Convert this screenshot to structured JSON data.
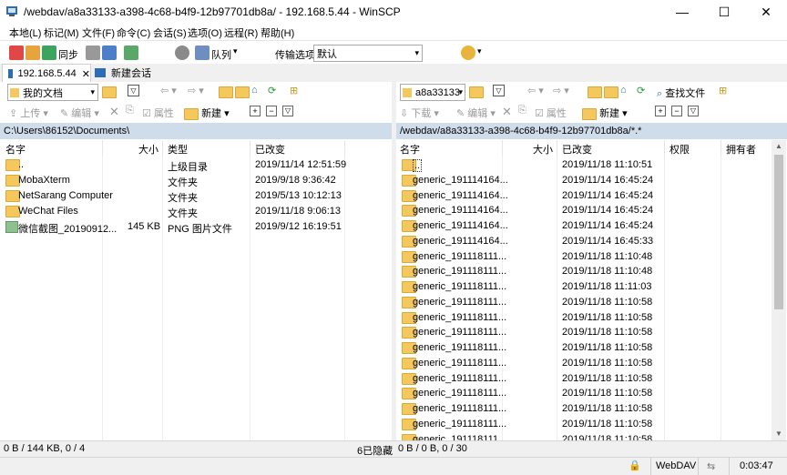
{
  "window": {
    "title": "/webdav/a8a33133-a398-4c68-b4f9-12b97701db8a/ - 192.168.5.44 - WinSCP",
    "minimize": "—",
    "maximize": "☐",
    "close": "✕"
  },
  "menu": [
    "本地(L)",
    "标记(M)",
    "文件(F)",
    "命令(C)",
    "会话(S)",
    "选项(O)",
    "远程(R)",
    "帮助(H)"
  ],
  "toolbar": {
    "sync_label": "同步",
    "queue_label": "队列",
    "transfer_label": "传输选项",
    "transfer_value": "默认"
  },
  "tabs": {
    "session": "192.168.5.44",
    "session_close": "✕",
    "new_session": "新建会话"
  },
  "left": {
    "location": "我的文档",
    "actions": {
      "upload": "上传",
      "edit": "编辑",
      "properties": "属性",
      "new": "新建"
    },
    "path": "C:\\Users\\86152\\Documents\\",
    "columns": [
      "名字",
      "大小",
      "类型",
      "已改变"
    ],
    "rows": [
      {
        "name": "..",
        "size": "",
        "type": "上级目录",
        "changed": "2019/11/14  12:51:59"
      },
      {
        "name": "MobaXterm",
        "size": "",
        "type": "文件夹",
        "changed": "2019/9/18  9:36:42"
      },
      {
        "name": "NetSarang Computer",
        "size": "",
        "type": "文件夹",
        "changed": "2019/5/13  10:12:13"
      },
      {
        "name": "WeChat Files",
        "size": "",
        "type": "文件夹",
        "changed": "2019/11/18  9:06:13"
      },
      {
        "name": "微信截图_20190912...",
        "size": "145 KB",
        "type": "PNG 图片文件",
        "changed": "2019/9/12  16:19:51"
      }
    ],
    "status": "0 B / 144 KB,   0 / 4",
    "hidden": "6已隐藏"
  },
  "right": {
    "location": "a8a33133",
    "find_files": "查找文件",
    "actions": {
      "download": "下载",
      "edit": "编辑",
      "properties": "属性",
      "new": "新建"
    },
    "path": "/webdav/a8a33133-a398-4c68-b4f9-12b97701db8a/*.*",
    "columns": [
      "名字",
      "大小",
      "已改变",
      "权限",
      "拥有者"
    ],
    "rows": [
      {
        "name": "..",
        "changed": "2019/11/18 11:10:51"
      },
      {
        "name": "generic_191114164...",
        "changed": "2019/11/14 16:45:24"
      },
      {
        "name": "generic_191114164...",
        "changed": "2019/11/14 16:45:24"
      },
      {
        "name": "generic_191114164...",
        "changed": "2019/11/14 16:45:24"
      },
      {
        "name": "generic_191114164...",
        "changed": "2019/11/14 16:45:24"
      },
      {
        "name": "generic_191114164...",
        "changed": "2019/11/14 16:45:33"
      },
      {
        "name": "generic_191118111...",
        "changed": "2019/11/18 11:10:48"
      },
      {
        "name": "generic_191118111...",
        "changed": "2019/11/18 11:10:48"
      },
      {
        "name": "generic_191118111...",
        "changed": "2019/11/18 11:11:03"
      },
      {
        "name": "generic_191118111...",
        "changed": "2019/11/18 11:10:58"
      },
      {
        "name": "generic_191118111...",
        "changed": "2019/11/18 11:10:58"
      },
      {
        "name": "generic_191118111...",
        "changed": "2019/11/18 11:10:58"
      },
      {
        "name": "generic_191118111...",
        "changed": "2019/11/18 11:10:58"
      },
      {
        "name": "generic_191118111...",
        "changed": "2019/11/18 11:10:58"
      },
      {
        "name": "generic_191118111...",
        "changed": "2019/11/18 11:10:58"
      },
      {
        "name": "generic_191118111...",
        "changed": "2019/11/18 11:10:58"
      },
      {
        "name": "generic_191118111...",
        "changed": "2019/11/18 11:10:58"
      },
      {
        "name": "generic_191118111...",
        "changed": "2019/11/18 11:10:58"
      },
      {
        "name": "generic_191118111...",
        "changed": "2019/11/18 11:10:58"
      }
    ],
    "status": "0 B / 0 B,   0 / 30"
  },
  "bottom": {
    "protocol": "WebDAV",
    "time": "0:03:47"
  },
  "colors": {
    "pathbar": "#cfdcea",
    "folder": "#f4c85c"
  }
}
